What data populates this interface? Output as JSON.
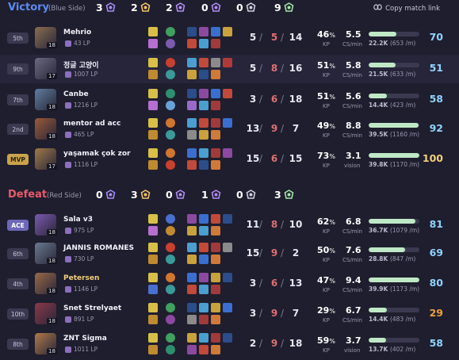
{
  "copy_link_label": "Copy match link",
  "teams": [
    {
      "result": "Victory",
      "side": "(Blue Side)",
      "result_color": "#5c8bf0",
      "objectives": [
        {
          "icon": "baron-icon",
          "value": "3",
          "color": "#a78bfa"
        },
        {
          "icon": "dragon-icon",
          "value": "2",
          "color": "#f4c36a"
        },
        {
          "icon": "herald-icon",
          "value": "2",
          "color": "#b18cf6"
        },
        {
          "icon": "void-grub-icon",
          "value": "0",
          "color": "#b18cf6"
        },
        {
          "icon": "inhibitor-icon",
          "value": "0",
          "color": "#d0cfe0"
        },
        {
          "icon": "tower-icon",
          "value": "9",
          "color": "#a3e6a8"
        }
      ],
      "players": [
        {
          "rank": "5th",
          "name": "Mehrio",
          "lp": "43 LP",
          "level": "18",
          "champ_color": "#8a6e52",
          "spells": [
            "#d8c048",
            "#b66fd0"
          ],
          "runes": [
            "#3fa060",
            "#7a5bb0"
          ],
          "items": [
            "#2b4d8a",
            "#8b4aa0",
            "#3a6fd0",
            "#c9a23b",
            "#c14a3a",
            "#4a9fd0",
            "#a13a3a"
          ],
          "kills": "5",
          "deaths": "5",
          "assists": "14",
          "kp": "46",
          "cs": "5.5",
          "damage": "22.2K",
          "dpm": "(653 /m)",
          "damage_share": 0.55,
          "score": "70",
          "score_color": "#8fd3ff",
          "hl": false
        },
        {
          "rank": "9th",
          "name": "정글 고양이",
          "lp": "1007 LP",
          "level": "17",
          "champ_color": "#6a6a80",
          "spells": [
            "#d8c048",
            "#c08a30"
          ],
          "runes": [
            "#c8402f",
            "#3a9a9a"
          ],
          "items": [
            "#4a9fd0",
            "#c14a3a",
            "#8b8b8b",
            "#b03a3a",
            "#c9a23b",
            "#2b4d8a",
            "#d07a3a"
          ],
          "kills": "5",
          "deaths": "8",
          "assists": "16",
          "kp": "51",
          "cs": "5.8",
          "damage": "21.5K",
          "dpm": "(633 /m)",
          "damage_share": 0.53,
          "score": "51",
          "score_color": "#8fd3ff",
          "hl": true
        },
        {
          "rank": "7th",
          "name": "Canbe",
          "lp": "1216 LP",
          "level": "18",
          "champ_color": "#5e7ea0",
          "spells": [
            "#d8c048",
            "#b66fd0"
          ],
          "runes": [
            "#2d8f6f",
            "#6aa0d8"
          ],
          "items": [
            "#2b4d8a",
            "#8b4aa0",
            "#3a6fd0",
            "#c14a3a",
            "#9a6ac8",
            "#4a9fd0",
            "#a13a3a"
          ],
          "kills": "3",
          "deaths": "6",
          "assists": "18",
          "kp": "51",
          "cs": "5.6",
          "damage": "14.4K",
          "dpm": "(423 /m)",
          "damage_share": 0.36,
          "score": "58",
          "score_color": "#8fd3ff",
          "hl": false
        },
        {
          "rank": "2nd",
          "name": "mentor ad acc",
          "lp": "465 LP",
          "level": "18",
          "champ_color": "#9a5a3a",
          "spells": [
            "#d8c048",
            "#c08a30"
          ],
          "runes": [
            "#d0762f",
            "#3a9a9a"
          ],
          "items": [
            "#4a9fd0",
            "#c14a3a",
            "#a13a3a",
            "#3a6fd0",
            "#8b8b8b",
            "#c9a23b",
            "#d07a3a"
          ],
          "kills": "13",
          "deaths": "9",
          "assists": "7",
          "kp": "49",
          "cs": "8.8",
          "damage": "39.5K",
          "dpm": "(1160 /m)",
          "damage_share": 0.98,
          "score": "92",
          "score_color": "#8fd3ff",
          "hl": false
        },
        {
          "rank": "MVP",
          "name": "yaşamak çok zor",
          "lp": "1116 LP",
          "level": "17",
          "champ_color": "#a07a4a",
          "spells": [
            "#d8c048",
            "#c08a30"
          ],
          "runes": [
            "#d0762f",
            "#c8402f"
          ],
          "items": [
            "#3a6fd0",
            "#4a9fd0",
            "#a13a3a",
            "#8b4aa0",
            "#c14a3a",
            "#2b4d8a",
            "#d07a3a"
          ],
          "kills": "15",
          "deaths": "6",
          "assists": "15",
          "kp": "73",
          "cs": "3.1",
          "cs_label": "vision",
          "damage": "39.8K",
          "dpm": "(1170 /m)",
          "damage_share": 1.0,
          "score": "100",
          "score_color": "#f1cf7c",
          "hl": false
        }
      ]
    },
    {
      "result": "Defeat",
      "side": "(Red Side)",
      "result_color": "#e85b6a",
      "objectives": [
        {
          "icon": "baron-icon",
          "value": "0",
          "color": "#a78bfa"
        },
        {
          "icon": "dragon-icon",
          "value": "3",
          "color": "#f4c36a"
        },
        {
          "icon": "herald-icon",
          "value": "0",
          "color": "#b18cf6"
        },
        {
          "icon": "void-grub-icon",
          "value": "1",
          "color": "#b18cf6"
        },
        {
          "icon": "inhibitor-icon",
          "value": "0",
          "color": "#d0cfe0"
        },
        {
          "icon": "tower-icon",
          "value": "3",
          "color": "#a3e6a8"
        }
      ],
      "players": [
        {
          "rank": "ACE",
          "name": "Sala v3",
          "lp": "975 LP",
          "level": "18",
          "champ_color": "#7a5ab0",
          "spells": [
            "#d8c048",
            "#b66fd0"
          ],
          "runes": [
            "#4a6fd0",
            "#c08a30"
          ],
          "items": [
            "#8b4aa0",
            "#3a6fd0",
            "#c14a3a",
            "#2b4d8a",
            "#c9a23b",
            "#4a9fd0",
            "#d07a3a"
          ],
          "kills": "11",
          "deaths": "8",
          "assists": "10",
          "kp": "62",
          "cs": "6.8",
          "damage": "36.7K",
          "dpm": "(1079 /m)",
          "damage_share": 0.92,
          "score": "81",
          "score_color": "#8fd3ff",
          "hl": false
        },
        {
          "rank": "6th",
          "name": "JANNIS ROMANES",
          "lp": "730 LP",
          "level": "18",
          "champ_color": "#6a7a90",
          "spells": [
            "#d8c048",
            "#c08a30"
          ],
          "runes": [
            "#c8402f",
            "#3a9a9a"
          ],
          "items": [
            "#4a9fd0",
            "#c14a3a",
            "#a13a3a",
            "#8b8b8b",
            "#c9a23b",
            "#3a6fd0",
            "#d07a3a"
          ],
          "kills": "15",
          "deaths": "9",
          "assists": "2",
          "kp": "50",
          "cs": "7.6",
          "damage": "28.8K",
          "dpm": "(847 /m)",
          "damage_share": 0.72,
          "score": "69",
          "score_color": "#8fd3ff",
          "hl": false
        },
        {
          "rank": "4th",
          "name": "Petersen",
          "lp": "1146 LP",
          "level": "18",
          "champ_color": "#9a6a4a",
          "spells": [
            "#d8c048",
            "#4a6fd0"
          ],
          "runes": [
            "#d0762f",
            "#3a9a9a"
          ],
          "items": [
            "#3a6fd0",
            "#8b4aa0",
            "#c9a23b",
            "#2b4d8a",
            "#c14a3a",
            "#4a9fd0",
            "#a13a3a"
          ],
          "kills": "3",
          "deaths": "6",
          "assists": "13",
          "kp": "47",
          "cs": "9.4",
          "damage": "39.9K",
          "dpm": "(1173 /m)",
          "damage_share": 1.0,
          "score": "80",
          "score_color": "#8fd3ff",
          "hl": false,
          "self": true
        },
        {
          "rank": "10th",
          "name": "Snet Strelyaet",
          "lp": "891 LP",
          "level": "18",
          "champ_color": "#8a3a4a",
          "spells": [
            "#d8c048",
            "#c08a30"
          ],
          "runes": [
            "#3fa060",
            "#8b4aa0"
          ],
          "items": [
            "#2b4d8a",
            "#4a9fd0",
            "#c9a23b",
            "#3a6fd0",
            "#8b8b8b",
            "#a13a3a",
            "#d07a3a"
          ],
          "kills": "3",
          "deaths": "9",
          "assists": "7",
          "kp": "29",
          "cs": "6.7",
          "damage": "14.4K",
          "dpm": "(483 /m)",
          "damage_share": 0.36,
          "score": "29",
          "score_color": "#f0a23b",
          "hl": false
        },
        {
          "rank": "8th",
          "name": "ZNT Sigma",
          "lp": "1011 LP",
          "level": "18",
          "champ_color": "#b07a4a",
          "spells": [
            "#d8c048",
            "#c08a30"
          ],
          "runes": [
            "#3fa060",
            "#2d8f6f"
          ],
          "items": [
            "#c9a23b",
            "#4a9fd0",
            "#a13a3a",
            "#2b4d8a",
            "#8b4aa0",
            "#c14a3a",
            "#d07a3a"
          ],
          "kills": "2",
          "deaths": "9",
          "assists": "18",
          "kp": "59",
          "cs": "3.7",
          "cs_label": "vision",
          "damage": "13.7K",
          "dpm": "(402 /m)",
          "damage_share": 0.34,
          "score": "58",
          "score_color": "#8fd3ff",
          "hl": false
        }
      ]
    }
  ],
  "labels": {
    "kp": "KP",
    "cs": "CS/min",
    "percent": "%"
  }
}
